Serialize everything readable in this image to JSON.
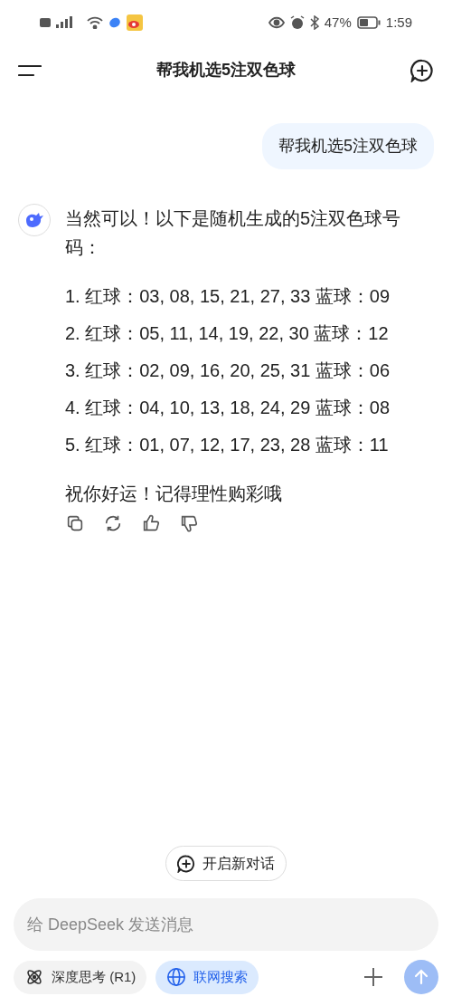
{
  "status_bar": {
    "battery": "47%",
    "time": "1:59"
  },
  "header": {
    "title": "帮我机选5注双色球"
  },
  "messages": [
    {
      "kind": "user",
      "text": "帮我机选5注双色球"
    },
    {
      "kind": "assistant",
      "paragraphs": [
        "当然可以！以下是随机生成的5注双色球号码："
      ],
      "list": [
        "1. 红球：03, 08, 15, 21, 27, 33 蓝球：09",
        "2. 红球：05, 11, 14, 19, 22, 30 蓝球：12",
        "3. 红球：02, 09, 16, 20, 25, 31 蓝球：06",
        "4. 红球：04, 10, 13, 18, 24, 29 蓝球：08",
        "5. 红球：01, 07, 12, 17, 23, 28 蓝球：11"
      ],
      "closing": "祝你好运！记得理性购彩哦"
    }
  ],
  "new_chat_button": "开启新对话",
  "input": {
    "placeholder": "给 DeepSeek 发送消息"
  },
  "toggles": [
    {
      "label": "深度思考 (R1)",
      "kind": "think",
      "on": false
    },
    {
      "label": "联网搜索",
      "kind": "web",
      "on": true
    }
  ]
}
